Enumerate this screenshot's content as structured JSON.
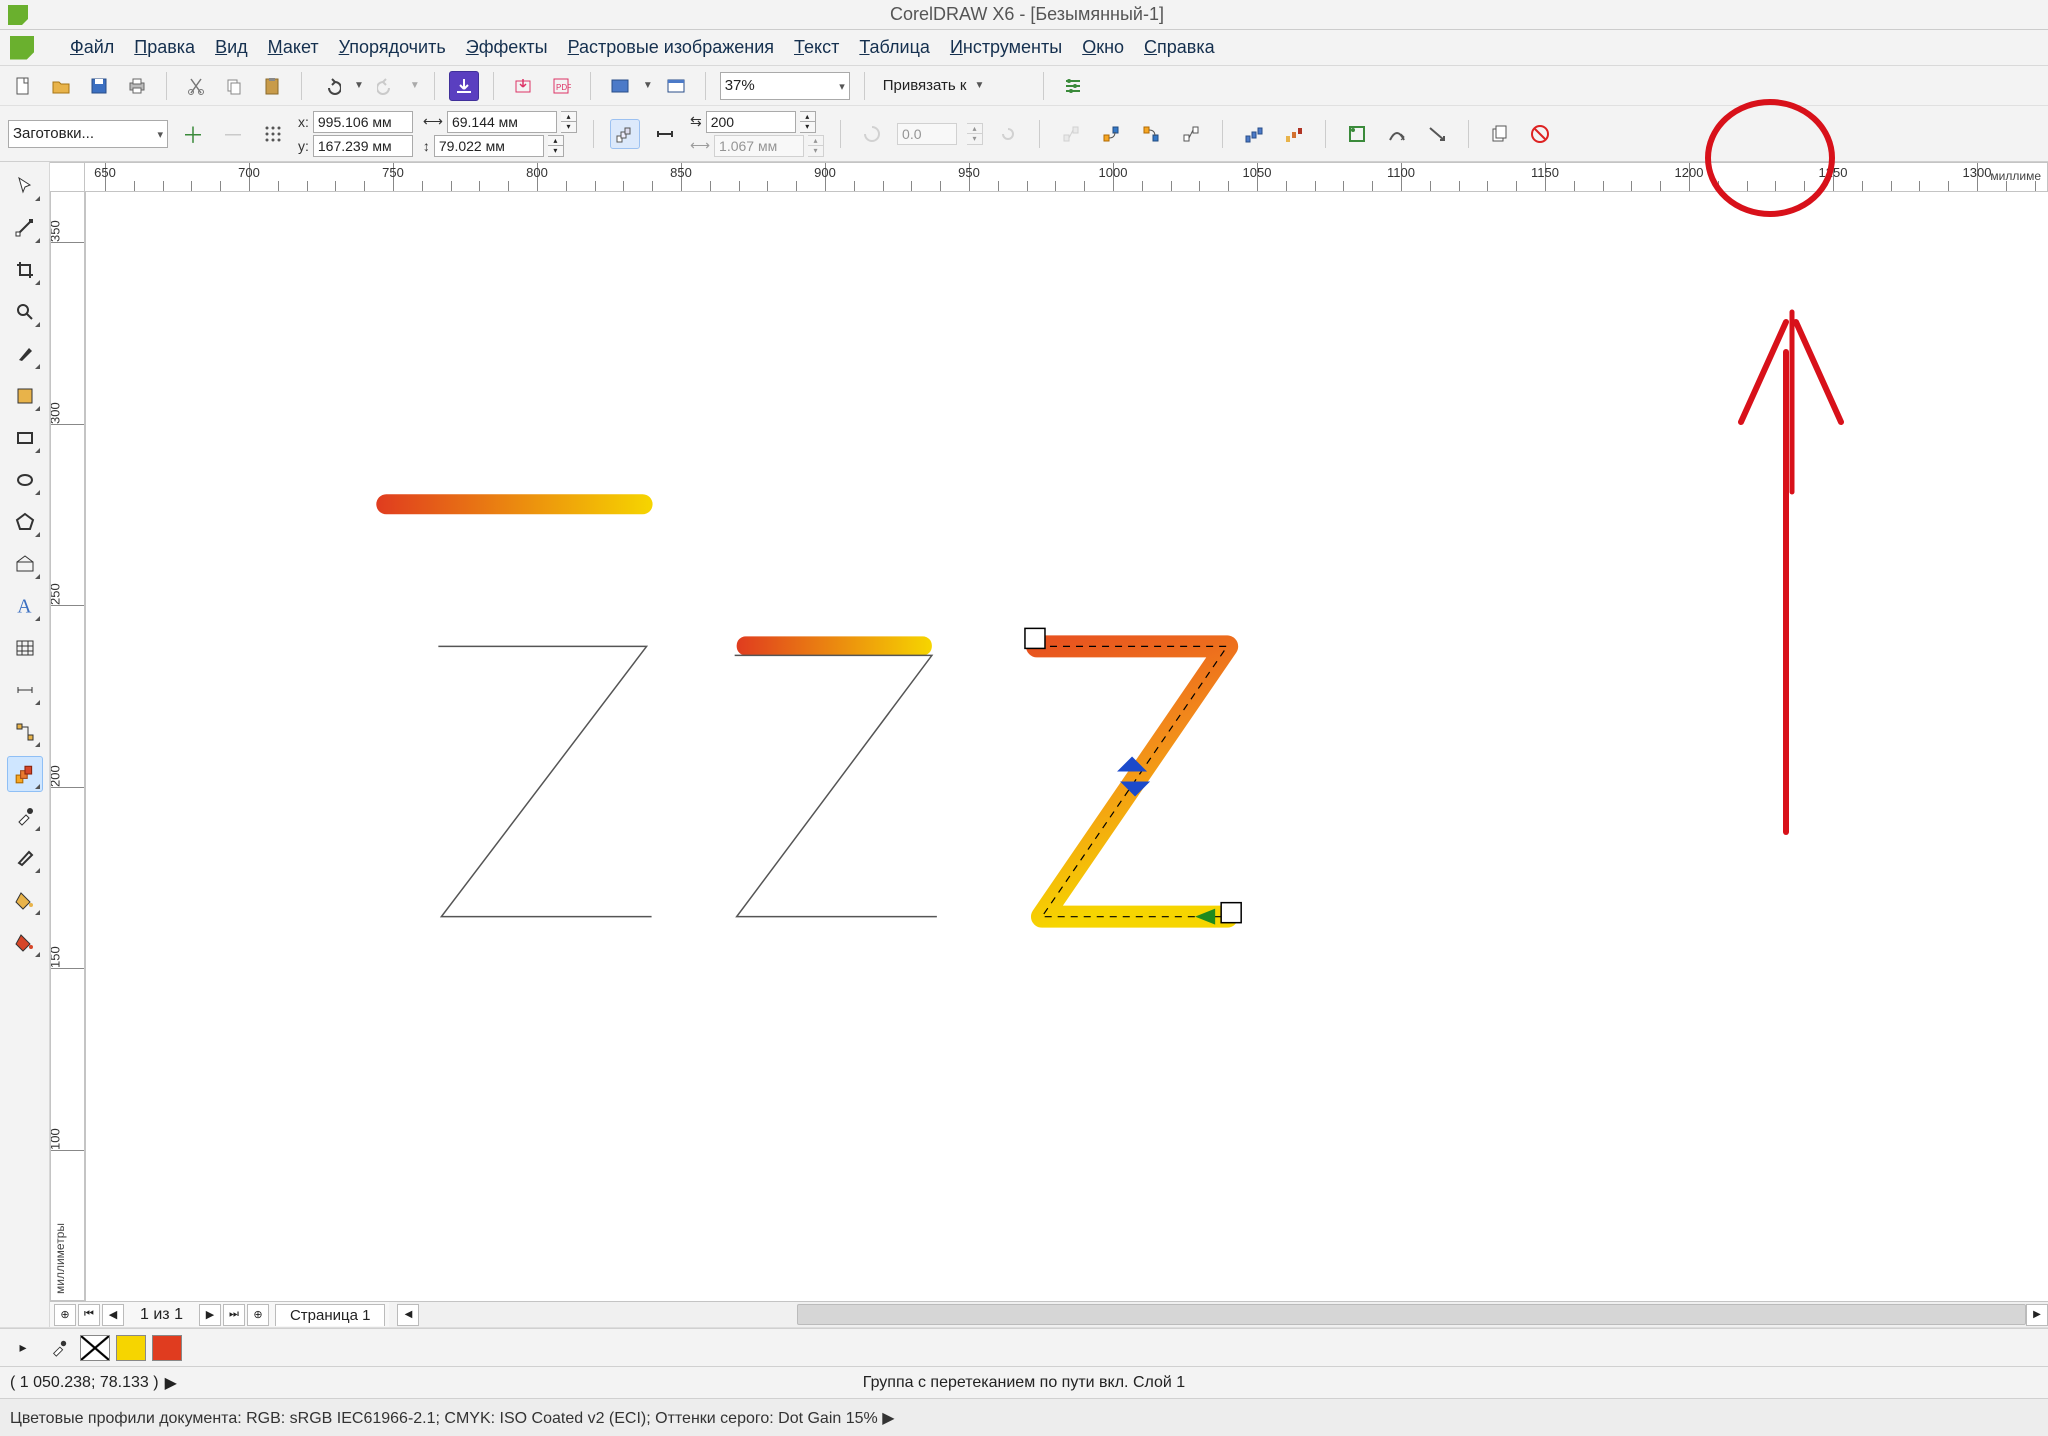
{
  "title": "CorelDRAW X6 - [Безымянный-1]",
  "menu": {
    "file": "Файл",
    "edit": "Правка",
    "view": "Вид",
    "layout": "Макет",
    "arrange": "Упорядочить",
    "effects": "Эффекты",
    "bitmaps": "Растровые изображения",
    "text": "Текст",
    "table": "Таблица",
    "tools": "Инструменты",
    "window": "Окно",
    "help": "Справка"
  },
  "standard_toolbar": {
    "zoom_value": "37%",
    "snap_label": "Привязать к"
  },
  "property_bar": {
    "presets_label": "Заготовки...",
    "x_label": "x:",
    "x_value": "995.106 мм",
    "y_label": "y:",
    "y_value": "167.239 мм",
    "w_value": "69.144 мм",
    "h_value": "79.022 мм",
    "steps_value": "200",
    "offset_value": "1.067 мм",
    "rotation_value": "0.0"
  },
  "ruler": {
    "h_start": 650,
    "h_end": 1300,
    "h_step": 50,
    "v_ticks": [
      350,
      300,
      250,
      200,
      150,
      100
    ],
    "h_unit": "миллиме",
    "v_unit": "миллиметры"
  },
  "page_nav": {
    "counter": "1 из 1",
    "tab": "Страница 1"
  },
  "color_bar": {
    "swatches": [
      {
        "kind": "none"
      },
      {
        "color": "#f6d500"
      },
      {
        "color": "#e03c1f"
      }
    ]
  },
  "status": {
    "coords": "( 1 050.238; 78.133 )",
    "selection": "Группа с перетеканием по пути вкл. Слой 1",
    "profiles": "Цветовые профили документа: RGB: sRGB IEC61966-2.1; CMYK: ISO Coated v2 (ECI); Оттенки серого: Dot Gain 15% ▶"
  }
}
